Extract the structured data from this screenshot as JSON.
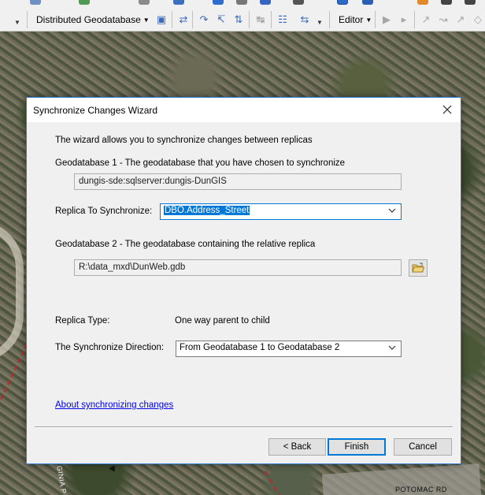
{
  "toolbar": {
    "geodatabase_menu_label": "Distributed Geodatabase",
    "editor_menu_label": "Editor"
  },
  "map": {
    "street_label": "POTOMAC RD",
    "street_label_2": "GINIA P"
  },
  "dialog": {
    "title": "Synchronize Changes Wizard",
    "intro_text": "The wizard allows you to synchronize changes between replicas",
    "gdb1_label": "Geodatabase 1 - The geodatabase that you have chosen to synchronize",
    "gdb1_value": "dungis-sde:sqlserver:dungis-DunGIS",
    "replica_label": "Replica To Synchronize:",
    "replica_value": "DBO.Address_Street",
    "gdb2_label": "Geodatabase 2 - The geodatabase containing the relative replica",
    "gdb2_value": "R:\\data_mxd\\DunWeb.gdb",
    "replica_type_label": "Replica Type:",
    "replica_type_value": "One way parent to child",
    "direction_label": "The Synchronize Direction:",
    "direction_value": "From Geodatabase 1 to Geodatabase 2",
    "help_link": "About synchronizing changes",
    "buttons": {
      "back": "< Back",
      "finish": "Finish",
      "cancel": "Cancel"
    }
  },
  "colors": {
    "accent": "#0078d7",
    "dialog_bg": "#f0f0f0",
    "link": "#0000ee",
    "boundary_line": "#c2262b"
  }
}
